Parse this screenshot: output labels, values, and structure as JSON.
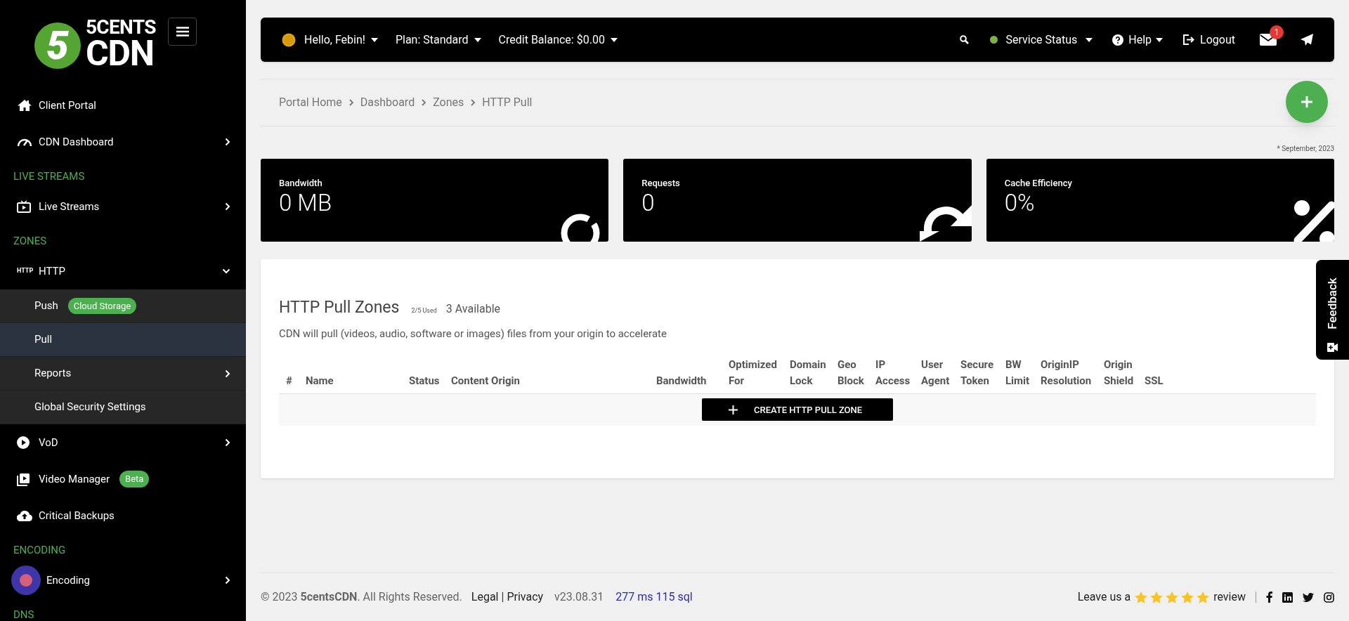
{
  "sidebar": {
    "logo": {
      "digit": "5",
      "line1": "5CENTS",
      "line2": "CDN"
    },
    "items": [
      {
        "kind": "item",
        "label": "Client Portal"
      },
      {
        "kind": "item",
        "label": "CDN Dashboard",
        "expanded": false
      },
      {
        "kind": "section",
        "label": "LIVE STREAMS"
      },
      {
        "kind": "item",
        "label": "Live Streams",
        "expanded": false
      },
      {
        "kind": "section",
        "label": "ZONES"
      },
      {
        "kind": "item",
        "icon_text": "HTTP",
        "label": "HTTP",
        "expanded": true,
        "children": [
          {
            "label": "Push",
            "badge": "Cloud Storage",
            "selected": false
          },
          {
            "label": "Pull",
            "selected": true
          },
          {
            "label": "Reports",
            "selected": false,
            "expanded": false
          },
          {
            "label": "Global Security Settings",
            "selected": false
          }
        ]
      },
      {
        "kind": "item",
        "label": "VoD",
        "expanded": false
      },
      {
        "kind": "item",
        "label": "Video Manager",
        "badge": "Beta"
      },
      {
        "kind": "item",
        "label": "Critical Backups"
      },
      {
        "kind": "section",
        "label": "ENCODING"
      },
      {
        "kind": "item",
        "label": "Encoding",
        "expanded": false
      },
      {
        "kind": "section",
        "label": "DNS"
      }
    ]
  },
  "topbar": {
    "left": [
      "Hello, Febin!",
      "Plan: Standard",
      "Credit Balance: $0.00"
    ],
    "status": {
      "label": "Service Status",
      "color": "#7cb342"
    },
    "help": "Help",
    "logout": "Logout",
    "mail_badge": "1"
  },
  "breadcrumbs": [
    "Portal Home",
    "Dashboard",
    "Zones",
    "HTTP Pull"
  ],
  "period_note": "* September, 2023",
  "stats": [
    {
      "label": "Bandwidth",
      "value": "0 MB"
    },
    {
      "label": "Requests",
      "value": "0"
    },
    {
      "label": "Cache Efficiency",
      "value": "0%"
    }
  ],
  "zones": {
    "title": "HTTP Pull Zones",
    "used": "2/5 Used",
    "available": "3 Available",
    "description": "CDN will pull (videos, audio, software or images) files from your origin to accelerate",
    "columns": [
      "#",
      "Name",
      "Status",
      "Content Origin",
      "Bandwidth",
      "Optimized For",
      "Domain Lock",
      "Geo Block",
      "IP Access",
      "User Agent",
      "Secure Token",
      "BW Limit",
      "OriginIP Resolution",
      "Origin Shield",
      "SSL"
    ],
    "create_button": "CREATE HTTP PULL ZONE"
  },
  "feedback": "Feedback",
  "footer": {
    "copyright": "© 2023 **5centsCDN**. All Rights Reserved.",
    "links": [
      "Legal",
      "Privacy"
    ],
    "link_separator": "|",
    "version": "v23.08.31",
    "timing": "277 ms 115 sql",
    "review_before": "Leave us a",
    "stars": 5,
    "review_after": "review"
  }
}
